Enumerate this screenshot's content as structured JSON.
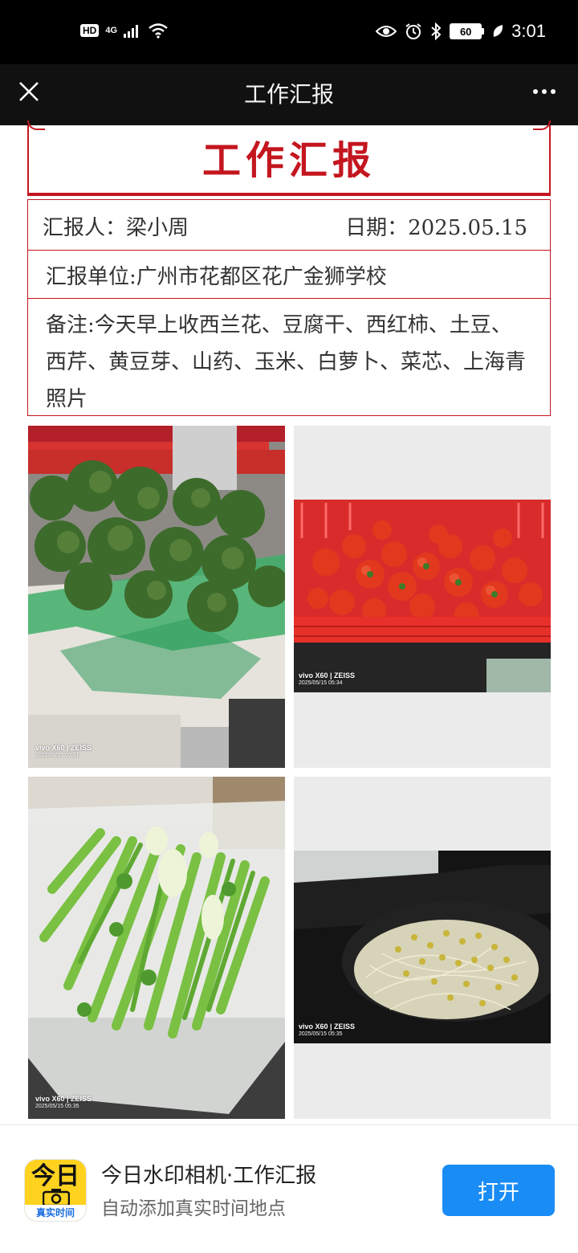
{
  "status_bar": {
    "hd": "HD",
    "network": "4G",
    "battery": "60",
    "time": "3:01"
  },
  "nav": {
    "title": "工作汇报",
    "close_icon": "close-icon",
    "more_icon": "more-icon"
  },
  "report": {
    "heading": "工作汇报",
    "reporter": "汇报人：梁小周",
    "date": "日期：2025.05.15",
    "unit": "汇报单位:广州市花都区花广金狮学校",
    "notes": "备注:今天早上收西兰花、豆腐干、西红柿、土豆、西芹、黄豆芽、山药、玉米、白萝卜、菜芯、上海青照片",
    "accent_color": "#c4161f"
  },
  "photos": [
    {
      "subject": "broccoli",
      "watermark_brand": "vivo X60 | ZEISS",
      "watermark_time": "2025/05/15 05:31"
    },
    {
      "subject": "tomatoes",
      "watermark_brand": "vivo X60 | ZEISS",
      "watermark_time": "2025/05/15 05:34"
    },
    {
      "subject": "celery",
      "watermark_brand": "vivo X60 | ZEISS",
      "watermark_time": "2025/05/15 05:35"
    },
    {
      "subject": "soybean sprouts",
      "watermark_brand": "vivo X60 | ZEISS",
      "watermark_time": "2025/05/15 05:35"
    }
  ],
  "banner": {
    "icon_top": "今日",
    "icon_bottom": "真实时间",
    "title": "今日水印相机·工作汇报",
    "subtitle": "自动添加真实时间地点",
    "open_label": "打开",
    "button_color": "#1a8cf5"
  }
}
